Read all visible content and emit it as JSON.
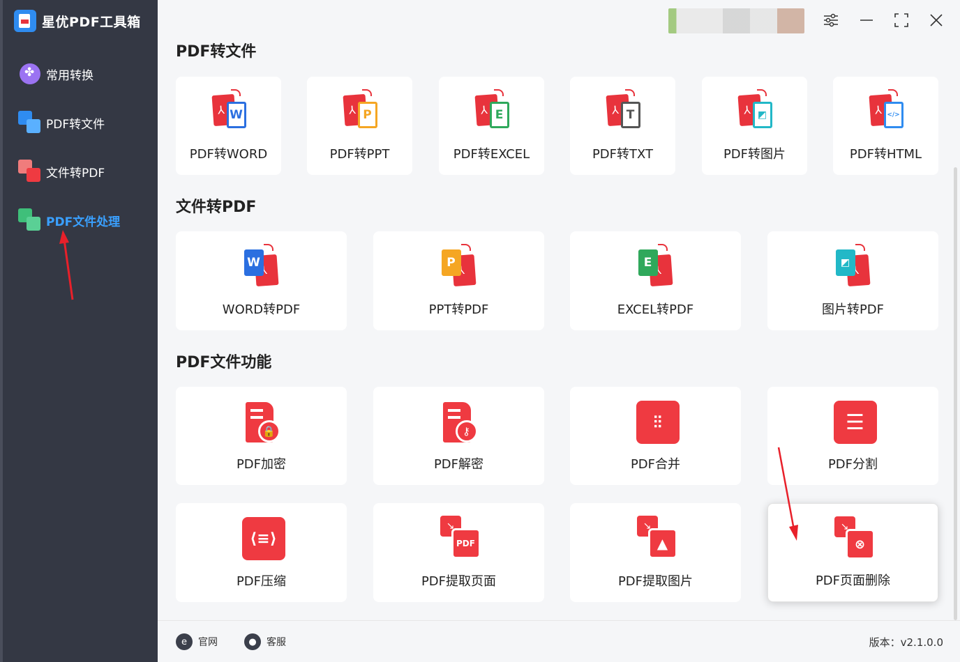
{
  "app": {
    "title": "星优PDF工具箱"
  },
  "sidebar": {
    "items": [
      {
        "label": "常用转换"
      },
      {
        "label": "PDF转文件"
      },
      {
        "label": "文件转PDF"
      },
      {
        "label": "PDF文件处理"
      }
    ]
  },
  "sections": [
    {
      "title": "PDF转文件",
      "cards": [
        {
          "label": "PDF转WORD",
          "letter": "W",
          "color": "#2b6fe0"
        },
        {
          "label": "PDF转PPT",
          "letter": "P",
          "color": "#f5a623"
        },
        {
          "label": "PDF转EXCEL",
          "letter": "E",
          "color": "#2fa85b"
        },
        {
          "label": "PDF转TXT",
          "letter": "T",
          "color": "#555555"
        },
        {
          "label": "PDF转图片",
          "letter": "◩",
          "color": "#22b8c7"
        },
        {
          "label": "PDF转HTML",
          "letter": "</>",
          "color": "#2f8cf0"
        }
      ]
    },
    {
      "title": "文件转PDF",
      "cards": [
        {
          "label": "WORD转PDF",
          "letter": "W",
          "color": "#2b6fe0"
        },
        {
          "label": "PPT转PDF",
          "letter": "P",
          "color": "#f5a623"
        },
        {
          "label": "EXCEL转PDF",
          "letter": "E",
          "color": "#2fa85b"
        },
        {
          "label": "图片转PDF",
          "letter": "◩",
          "color": "#22b8c7"
        }
      ]
    },
    {
      "title": "PDF文件功能",
      "cards": [
        {
          "label": "PDF加密",
          "glyph": "🔒"
        },
        {
          "label": "PDF解密",
          "glyph": "⚷"
        },
        {
          "label": "PDF合并",
          "glyph": "⫶⫶"
        },
        {
          "label": "PDF分割",
          "glyph": "☰"
        },
        {
          "label": "PDF压缩",
          "glyph": "⟨≡⟩"
        },
        {
          "label": "PDF提取页面",
          "glyph": "PDF"
        },
        {
          "label": "PDF提取图片",
          "glyph": "▲"
        },
        {
          "label": "PDF页面删除",
          "glyph": "⊗"
        }
      ]
    }
  ],
  "footer": {
    "website": "官网",
    "support": "客服",
    "version": "版本：v2.1.0.0"
  },
  "colors": {
    "accent": "#3aa0ff",
    "brand_red": "#ef3a41",
    "sidebar": "#343844"
  }
}
